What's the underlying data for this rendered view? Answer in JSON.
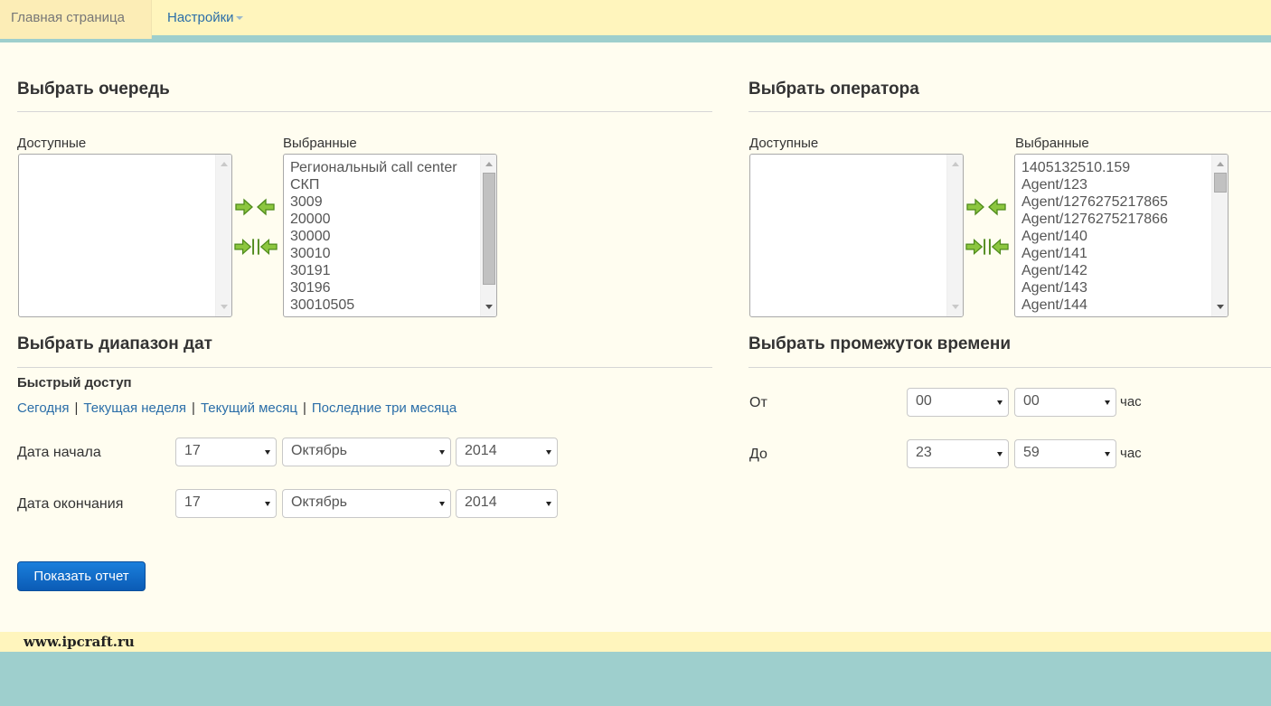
{
  "nav": {
    "home": "Главная страница",
    "settings": "Настройки"
  },
  "queue": {
    "title": "Выбрать очередь",
    "available_label": "Доступные",
    "selected_label": "Выбранные",
    "selected_items": [
      "Региональный call center",
      "СКП",
      "3009",
      "20000",
      "30000",
      "30010",
      "30191",
      "30196",
      "30010505"
    ]
  },
  "operator": {
    "title": "Выбрать оператора",
    "available_label": "Доступные",
    "selected_label": "Выбранные",
    "selected_items": [
      "1405132510.159",
      "Agent/123",
      "Agent/1276275217865",
      "Agent/1276275217866",
      "Agent/140",
      "Agent/141",
      "Agent/142",
      "Agent/143",
      "Agent/144"
    ]
  },
  "dates": {
    "title": "Выбрать диапазон дат",
    "quick_label": "Быстрый доступ",
    "quick_links": [
      "Сегодня",
      "Текущая неделя",
      "Текущий месяц",
      "Последние три месяца"
    ],
    "start_label": "Дата начала",
    "end_label": "Дата окончания",
    "start": {
      "day": "17",
      "month": "Октябрь",
      "year": "2014"
    },
    "end": {
      "day": "17",
      "month": "Октябрь",
      "year": "2014"
    }
  },
  "time": {
    "title": "Выбрать промежуток времени",
    "from_label": "От",
    "to_label": "До",
    "from": {
      "hour": "00",
      "minute": "00"
    },
    "to": {
      "hour": "23",
      "minute": "59"
    },
    "unit": "час"
  },
  "report_button": "Показать отчет",
  "footer": "www.ipcraft.ru",
  "icons": [
    "arrow-right-icon",
    "arrow-left-icon",
    "move-all-right-icon",
    "move-all-left-icon"
  ],
  "colors": {
    "nav_bg": "#fff5bd",
    "accent": "#9ecfcd",
    "link": "#2b6ea8",
    "button": "#0b5bb5"
  }
}
